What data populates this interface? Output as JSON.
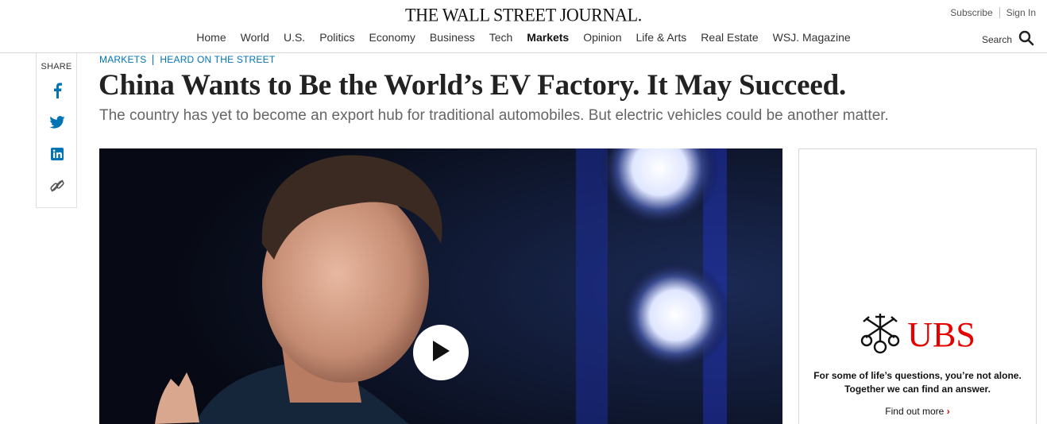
{
  "header": {
    "logo_text": "THE WALL STREET JOURNAL.",
    "subscribe_label": "Subscribe",
    "signin_label": "Sign In",
    "search_label": "Search"
  },
  "nav": {
    "items": [
      {
        "label": "Home"
      },
      {
        "label": "World"
      },
      {
        "label": "U.S."
      },
      {
        "label": "Politics"
      },
      {
        "label": "Economy"
      },
      {
        "label": "Business"
      },
      {
        "label": "Tech"
      },
      {
        "label": "Markets",
        "active": true
      },
      {
        "label": "Opinion"
      },
      {
        "label": "Life & Arts"
      },
      {
        "label": "Real Estate"
      },
      {
        "label": "WSJ. Magazine"
      }
    ]
  },
  "share": {
    "label": "SHARE",
    "icons": [
      "facebook-icon",
      "twitter-icon",
      "linkedin-icon",
      "copy-link-icon"
    ]
  },
  "article": {
    "kicker_section": "MARKETS",
    "kicker_column": "HEARD ON THE STREET",
    "headline": "China Wants to Be the World’s EV Factory. It May Succeed.",
    "dek": "The country has yet to become an export hub for traditional automobiles. But electric vehicles could be another matter.",
    "media_icon": "play-icon"
  },
  "ad": {
    "brand": "UBS",
    "brand_icon": "ubs-keys-logo",
    "line1": "For some of life’s questions, you’re not alone.",
    "line2": "Together we can find an answer.",
    "cta": "Find out more",
    "cta_chevron": "›"
  },
  "colors": {
    "kicker_blue": "#0274b6",
    "ubs_red": "#e60000",
    "headline": "#222222",
    "dek": "#666666"
  }
}
